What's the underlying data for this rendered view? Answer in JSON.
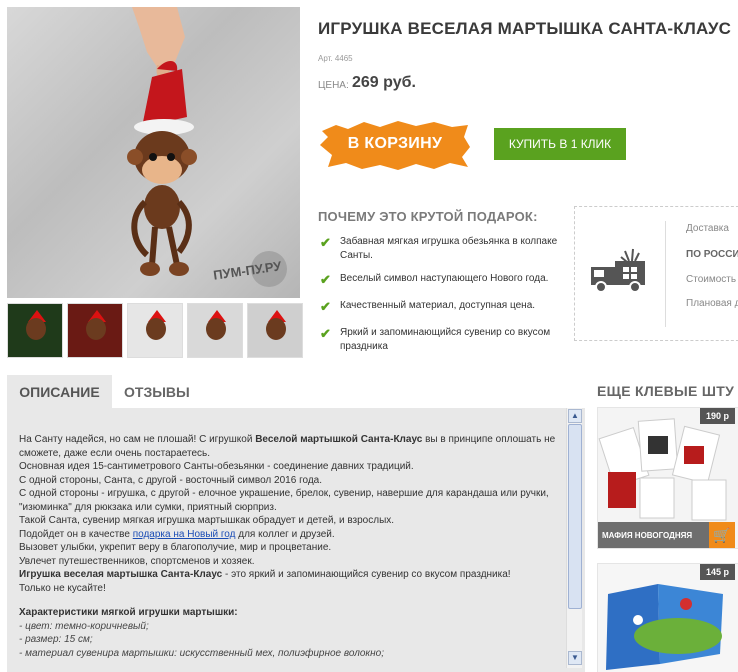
{
  "product": {
    "title": "ИГРУШКА ВЕСЕЛАЯ МАРТЫШКА САНТА-КЛАУС",
    "sku": "Арт. 4465",
    "price_label": "ЦЕНА:",
    "price": "269 руб.",
    "watermark": "ПУМ-ПУ.РУ"
  },
  "buttons": {
    "cart": "В КОРЗИНУ",
    "one_click": "КУПИТЬ В 1 КЛИК"
  },
  "why": {
    "title": "ПОЧЕМУ ЭТО КРУТОЙ ПОДАРОК:",
    "items": [
      "Забавная мягкая игрушка обезьянка в колпаке Санты.",
      "Веселый символ наступающего Нового года.",
      "Качественный материал, доступная цена.",
      "Яркий и запоминающийся сувенир со вкусом праздника"
    ]
  },
  "delivery": {
    "rows": [
      "Доставка",
      "ПО РОССИ",
      "Стоимость",
      "Плановая д"
    ]
  },
  "tabs": {
    "description": "ОПИСАНИЕ",
    "reviews": "ОТЗЫВЫ"
  },
  "description": {
    "p1_a": "На Санту надейся, но сам не плошай! С игрушкой ",
    "p1_b": "Веселой мартышкой Санта-Клаус",
    "p1_c": " вы в принципе оплошать не сможете, даже если очень постараетесь.",
    "p2": "Основная идея 15-сантиметрового Санты-обезьянки - соединение давних традиций.",
    "p3": "С одной стороны, Санта, с другой - восточный символ 2016 года.",
    "p4": "С одной стороны - игрушка, с другой - елочное украшение, брелок, сувенир, навершие для карандаша или ручки, \"изюминка\" для рюкзака или сумки, приятный сюрприз.",
    "p5": "Такой Санта, сувенир мягкая игрушка мартышкак обрадует и детей, и взрослых.",
    "p6_a": "Подойдет он в качестве ",
    "p6_link": "подарка на Новый год",
    "p6_b": " для коллег и друзей.",
    "p7": "Вызовет улыбки, укрепит веру в благополучие, мир и процветание.",
    "p8": "Увлечет путешественников, спортсменов и хозяек.",
    "p9_a": "Игрушка веселая мартышка Санта-Клаус",
    "p9_b": " - это яркий и запоминающийся сувенир со вкусом праздника!",
    "p10": "Только не кусайте!",
    "spec_title": "Характеристики мягкой игрушки мартышки:",
    "spec1": "- цвет: темно-коричневый;",
    "spec2": "- размер: 15 см;",
    "spec3": "- материал сувенира мартышки: искусственный мех, полиэфирное волокно;"
  },
  "sidebar": {
    "title": "ЕЩЕ КЛЕВЫЕ ШТУ",
    "cards": [
      {
        "price": "190 р",
        "caption": "МАФИЯ НОВОГОДНЯЯ"
      },
      {
        "price": "145 р",
        "caption": ""
      }
    ]
  },
  "colors": {
    "accent_orange": "#f08b1a",
    "green": "#5aa21f",
    "link": "#1a4cb5"
  }
}
